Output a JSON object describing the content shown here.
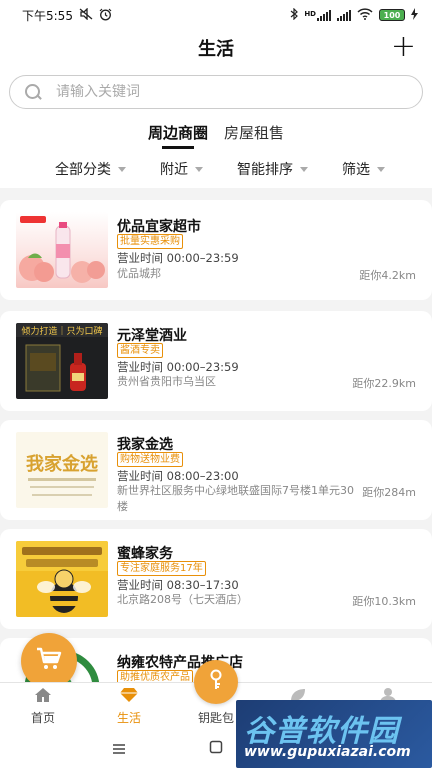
{
  "status_bar": {
    "time": "下午5:55",
    "battery": "100",
    "network_type": "HD",
    "icons": [
      "mute-icon",
      "alarm-icon",
      "bluetooth-icon",
      "signal-icon",
      "wifi-icon",
      "battery-icon",
      "charging-icon"
    ]
  },
  "header": {
    "title": "生活",
    "add_label": "+"
  },
  "search": {
    "placeholder": "请输入关键词"
  },
  "tabs": [
    {
      "label": "周边商圈",
      "active": true
    },
    {
      "label": "房屋租售",
      "active": false
    }
  ],
  "filters": [
    {
      "label": "全部分类"
    },
    {
      "label": "附近"
    },
    {
      "label": "智能排序"
    },
    {
      "label": "筛选"
    }
  ],
  "shops": [
    {
      "name": "优品宜家超市",
      "tag": "批量实惠采购",
      "hours": "营业时间 00:00–23:59",
      "address": "优品城邦",
      "distance": "距你4.2km",
      "thumb_icon": "peach-drink-icon"
    },
    {
      "name": "元泽堂酒业",
      "tag": "酱酒专卖",
      "hours": "营业时间 00:00–23:59",
      "address": "贵州省贵阳市乌当区",
      "distance": "距你22.9km",
      "thumb_icon": "liquor-bottle-icon"
    },
    {
      "name": "我家金选",
      "tag": "购物送物业费",
      "hours": "营业时间 08:00–23:00",
      "address": "新世界社区服务中心绿地联盛国际7号楼1单元30楼",
      "distance": "距你284m",
      "thumb_icon": "calligraphy-banner-icon"
    },
    {
      "name": "蜜蜂家务",
      "tag": "专注家庭服务17年",
      "hours": "营业时间 08:30–17:30",
      "address": "北京路208号（七天酒店）",
      "distance": "距你10.3km",
      "thumb_icon": "bee-mascot-icon"
    },
    {
      "name": "纳雍农特产品推广店",
      "tag": "助推优质农产品",
      "thumb_icon": "green-leaf-logo-icon"
    }
  ],
  "bottom_nav": [
    {
      "label": "首页",
      "icon": "home-icon",
      "active": false
    },
    {
      "label": "生活",
      "icon": "diamond-icon",
      "active": true
    },
    {
      "label": "钥匙包",
      "icon": "key-icon",
      "active": false
    },
    {
      "label": "",
      "icon": "leaf-icon",
      "active": false
    },
    {
      "label": "",
      "icon": "person-icon",
      "active": false
    }
  ],
  "watermark": {
    "text": "谷普软件园",
    "url": "www.gupuxiazai.com"
  },
  "colors": {
    "accent": "#f0a339",
    "tag": "#e8900a",
    "background": "#f3f3f3"
  }
}
